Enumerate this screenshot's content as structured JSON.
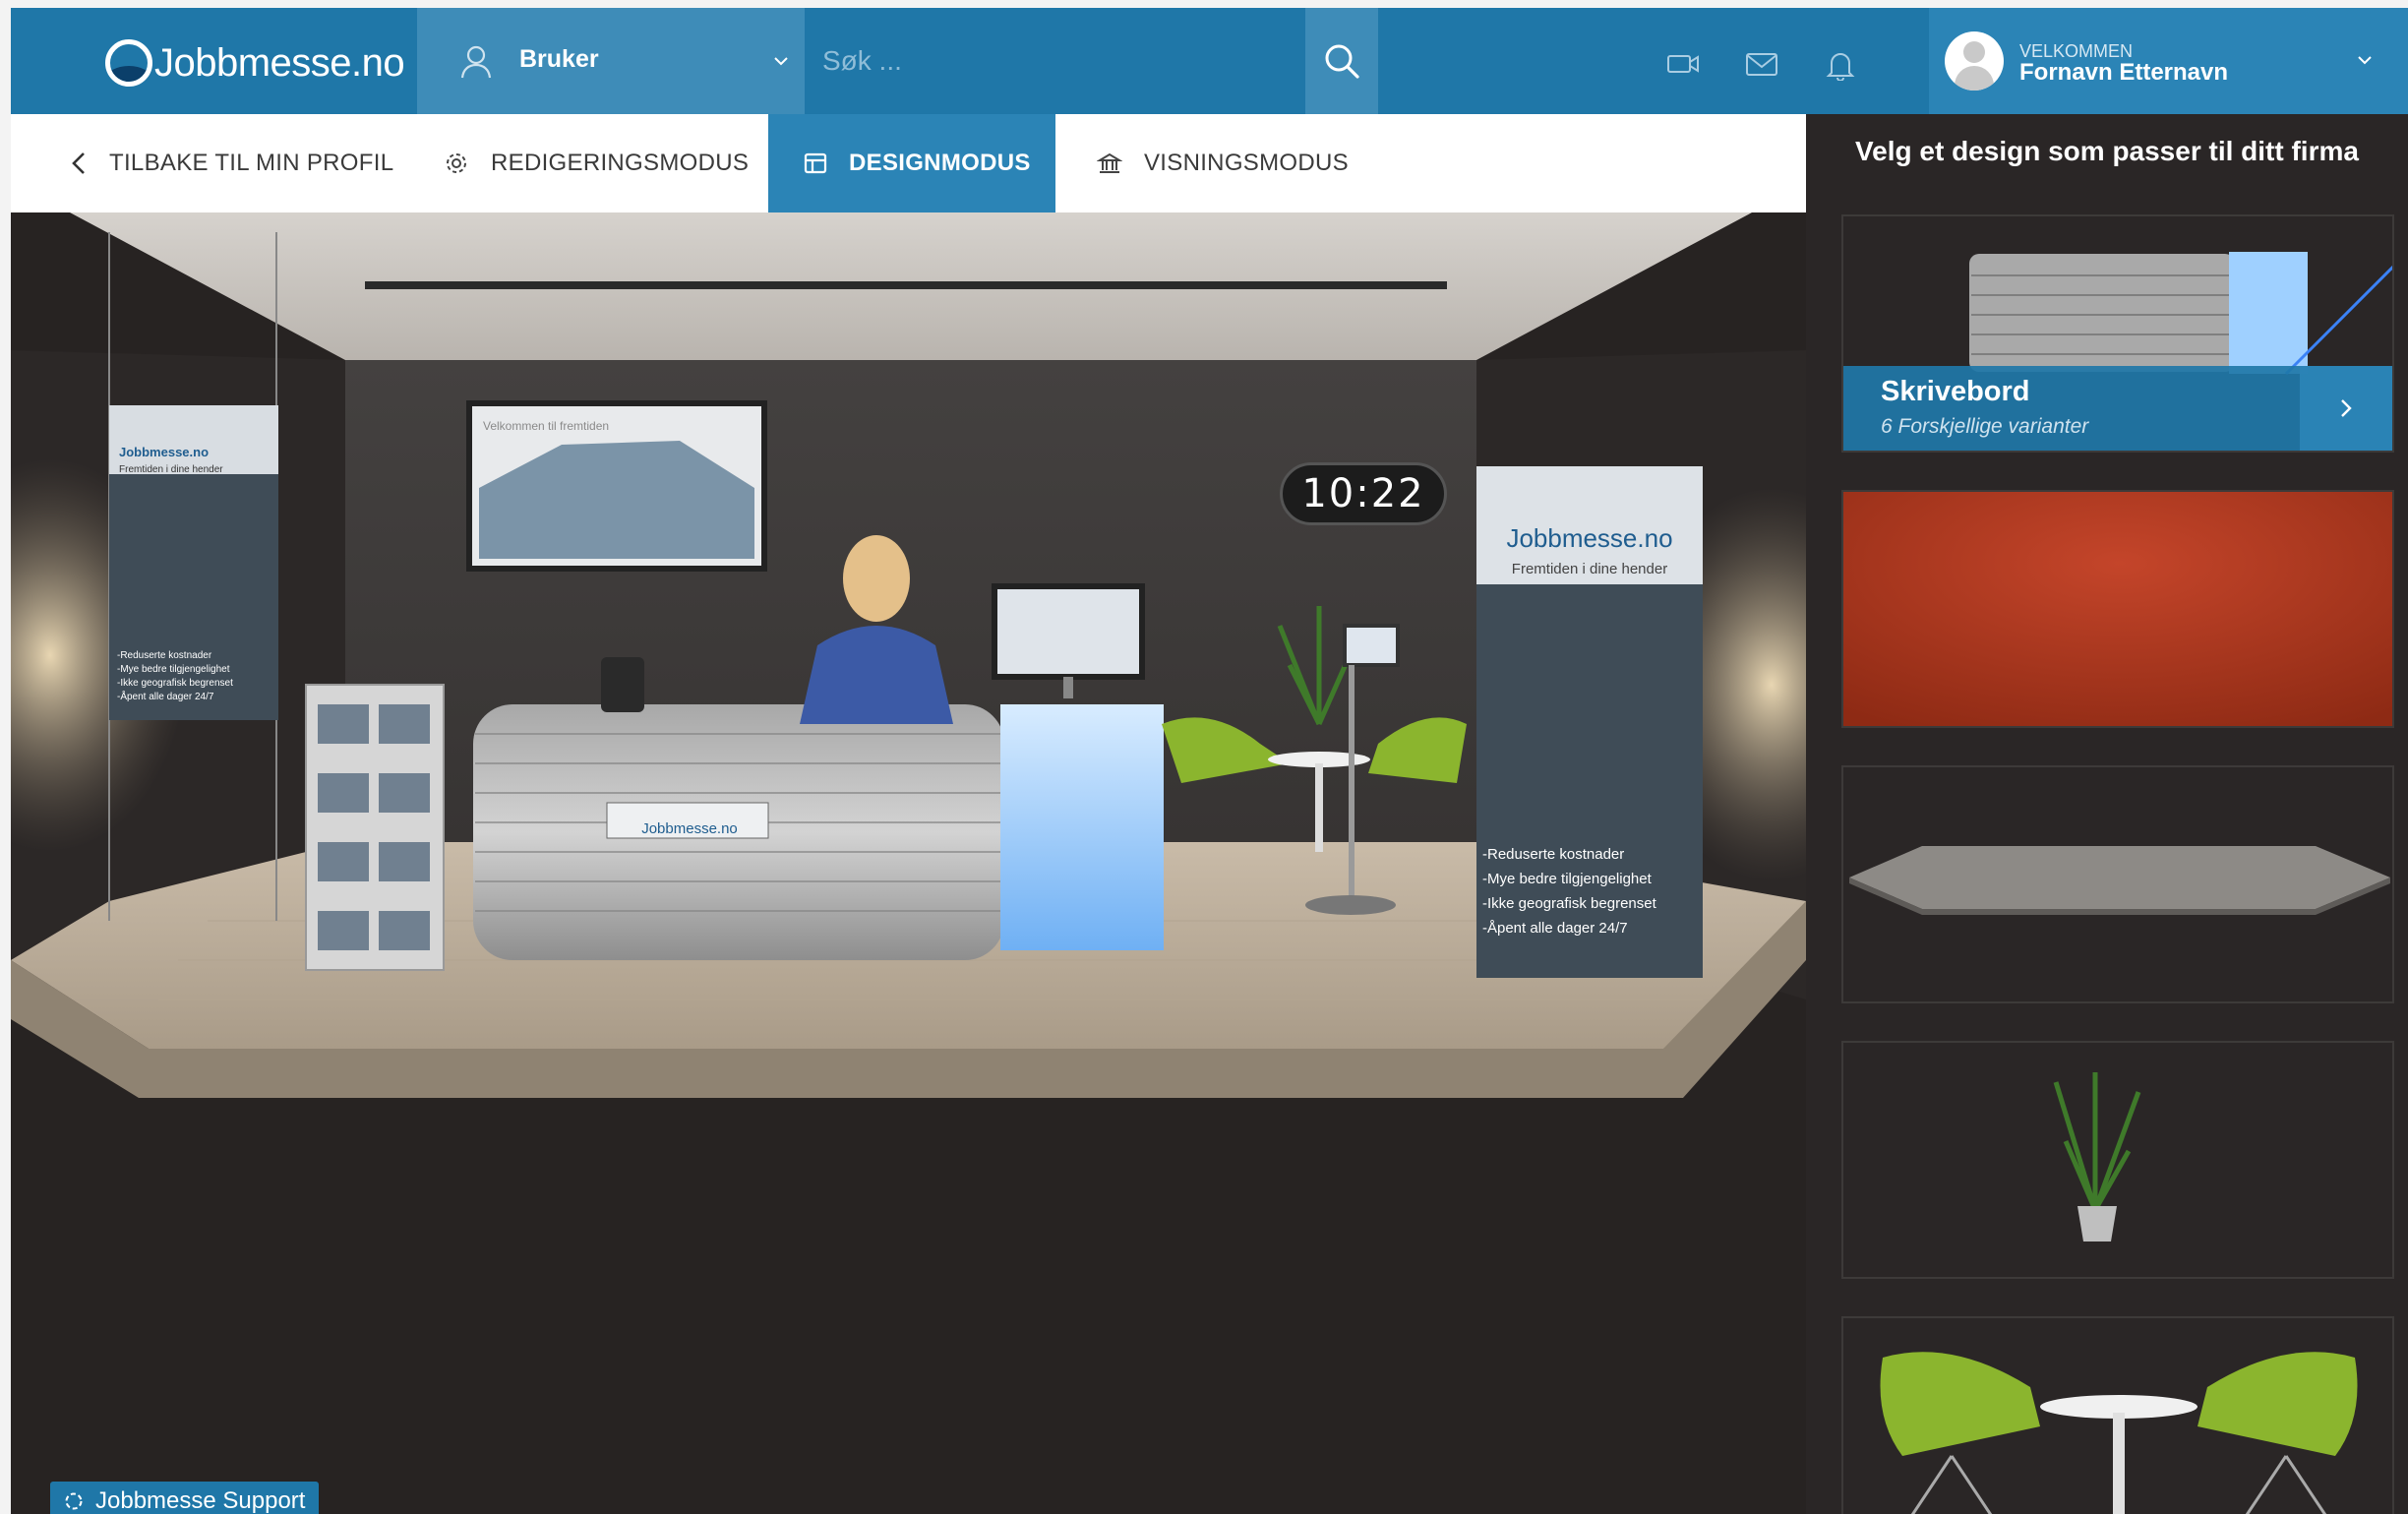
{
  "brand": {
    "logo_text": "Jobbmesse.no",
    "accent": "#1f77a8",
    "accent_light": "#3e8cb8"
  },
  "topbar": {
    "user_dropdown_label": "Bruker",
    "search_placeholder": "Søk ...",
    "welcome_small": "VELKOMMEN",
    "user_name": "Fornavn Etternavn",
    "icons": [
      "user-icon",
      "search-icon",
      "video-icon",
      "mail-icon",
      "bell-icon",
      "avatar",
      "chevron-down-icon"
    ]
  },
  "modebar": {
    "back": "TILBAKE TIL MIN PROFIL",
    "edit": "REDIGERINGSMODUS",
    "design": "DESIGNMODUS",
    "view": "VISNINGSMODUS",
    "active": "design"
  },
  "booth": {
    "clock": "10:22",
    "screen_text": "Velkommen til fremtiden",
    "banner_logo": "Jobbmesse.no",
    "banner_tagline": "Fremtiden i dine hender",
    "banner_points": [
      "-Reduserte kostnader",
      "-Mye bedre tilgjengelighet",
      "-Ikke geografisk begrenset",
      "-Åpent alle dager 24/7"
    ],
    "desk_logo": "Jobbmesse.no"
  },
  "support": {
    "label": "Jobbmesse Support"
  },
  "panel": {
    "title": "Velg et design som passer til ditt firma",
    "cards": [
      {
        "title": "Skrivebord",
        "subtitle": "6 Forskjellige varianter"
      },
      {
        "title": "",
        "subtitle": ""
      },
      {
        "title": "",
        "subtitle": ""
      },
      {
        "title": "",
        "subtitle": ""
      },
      {
        "title": "",
        "subtitle": ""
      }
    ]
  }
}
